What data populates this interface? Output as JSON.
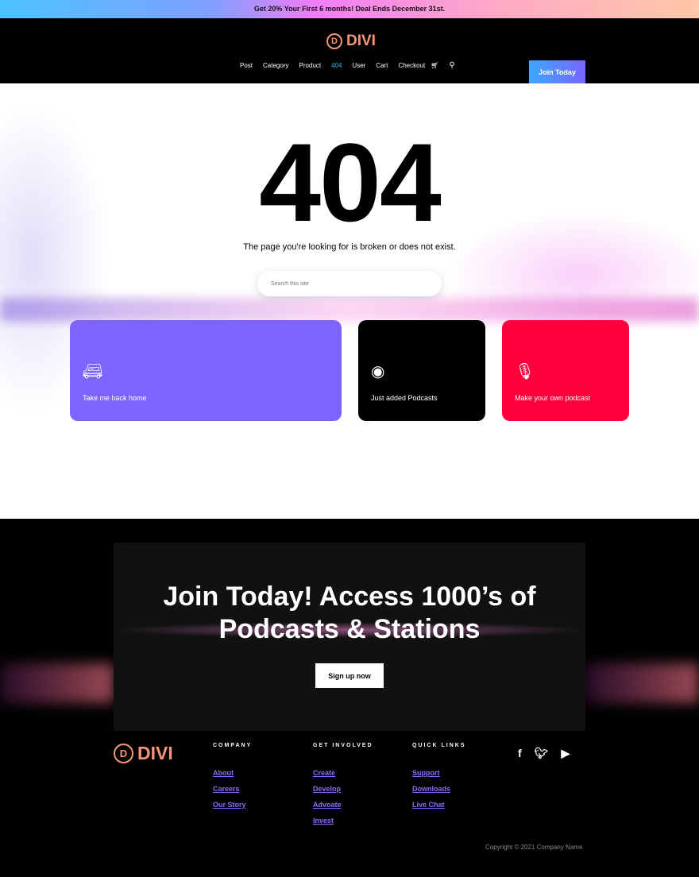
{
  "promo": "Get 20% Your First 6 months! Deal Ends December 31st.",
  "brand": {
    "mark": "D",
    "name": "DIVI",
    "color": "#f6957a"
  },
  "nav": {
    "items": [
      "Post",
      "Category",
      "Product",
      "404",
      "User",
      "Cart",
      "Checkout"
    ],
    "active": "404",
    "cart_icon": "cart-icon",
    "search_icon": "search-icon"
  },
  "join_button": "Join Today",
  "hero": {
    "code": "404",
    "message": "The page you're looking for is broken or does not exist.",
    "search_placeholder": "Search this site"
  },
  "cards": [
    {
      "label": "Take me back home",
      "icon": "camper-trailer-icon",
      "color": "#7f63ff"
    },
    {
      "label": "Just added Podcasts",
      "icon": "podcast-icon",
      "color": "#000000"
    },
    {
      "label": "Make your own podcast",
      "icon": "microphone-icon",
      "color": "#ff003c"
    }
  ],
  "cta": {
    "title_line1": "Join Today! Access 1000’s of",
    "title_line2": "Podcasts & Stations",
    "button": "Sign up now"
  },
  "footer": {
    "columns": [
      {
        "heading": "COMPANY",
        "links": [
          "About",
          "Careers",
          "Our Story"
        ]
      },
      {
        "heading": "GET INVOLVED",
        "links": [
          "Create",
          "Develop",
          "Advoate",
          "Invest"
        ]
      },
      {
        "heading": "QUICK LINKS",
        "links": [
          "Support",
          "Downloads",
          "Live Chat"
        ]
      }
    ],
    "social": [
      "facebook-icon",
      "twitter-icon",
      "youtube-icon"
    ],
    "copyright": "Copyright © 2021 Company Name"
  }
}
